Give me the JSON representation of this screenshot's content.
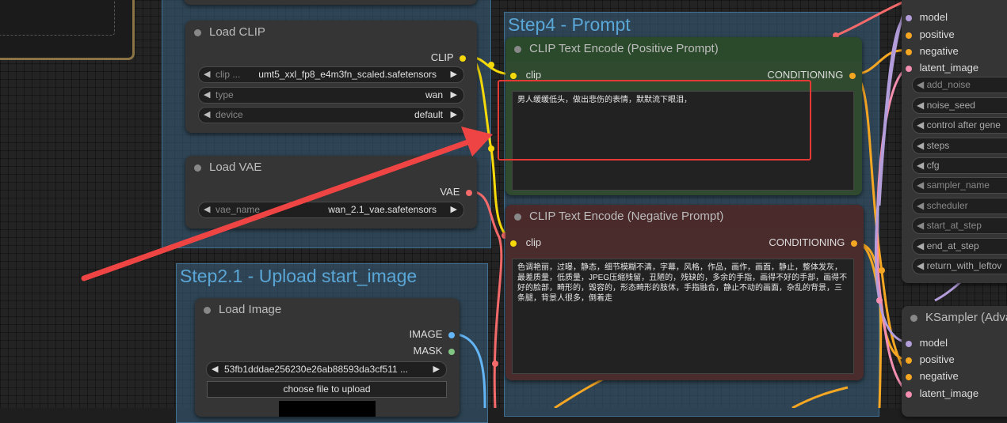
{
  "groups": {
    "step4": {
      "title": "Step4 -  Prompt"
    },
    "step2_1": {
      "title": "Step2.1 - Upload start_image"
    }
  },
  "load_clip": {
    "title": "Load CLIP",
    "output": "CLIP",
    "widgets": [
      {
        "label": "clip ...",
        "value": "umt5_xxl_fp8_e4m3fn_scaled.safetensors"
      },
      {
        "label": "type",
        "value": "wan"
      },
      {
        "label": "device",
        "value": "default"
      }
    ]
  },
  "load_vae": {
    "title": "Load VAE",
    "output": "VAE",
    "widgets": [
      {
        "label": "vae_name",
        "value": "wan_2.1_vae.safetensors"
      }
    ]
  },
  "load_image": {
    "title": "Load Image",
    "outputs": [
      "IMAGE",
      "MASK"
    ],
    "file_value": "53fb1dddae256230e26ab88593da3cf511 ...",
    "upload_label": "choose file to upload"
  },
  "positive": {
    "title": "CLIP Text Encode (Positive Prompt)",
    "input": "clip",
    "output": "CONDITIONING",
    "text": "男人缓缓低头，做出悲伤的表情，默默流下眼泪，",
    "color": "#2e4a2e"
  },
  "negative": {
    "title": "CLIP Text Encode (Negative Prompt)",
    "input": "clip",
    "output": "CONDITIONING",
    "text": "色调艳丽，过曝，静态，细节模糊不清，字幕，风格，作品，画作，画面，静止，整体发灰，最差质量，低质量，JPEG压缩残留，丑陋的，残缺的，多余的手指，画得不好的手部，画得不好的脸部，畸形的，毁容的，形态畸形的肢体，手指融合，静止不动的画面，杂乱的背景，三条腿，背景人很多，倒着走",
    "color": "#4a2a2a"
  },
  "ksampler1": {
    "inputs": [
      "model",
      "positive",
      "negative",
      "latent_image"
    ],
    "widgets": [
      "add_noise",
      "noise_seed",
      "control after gene",
      "steps",
      "cfg",
      "sampler_name",
      "scheduler",
      "start_at_step",
      "end_at_step",
      "return_with_leftov"
    ]
  },
  "ksampler2": {
    "title": "KSampler (Adva",
    "inputs": [
      "model",
      "positive",
      "negative",
      "latent_image"
    ]
  },
  "colors": {
    "highlight": "#e53935",
    "arrow": "#ef4444",
    "clip_port": "#f5d90a",
    "vae_port": "#f46a6a",
    "image_port": "#64b5f6",
    "mask_port": "#81c784",
    "cond_port": "#f5a623",
    "model_port": "#b39ddb",
    "latent_port": "#f48fb1"
  }
}
